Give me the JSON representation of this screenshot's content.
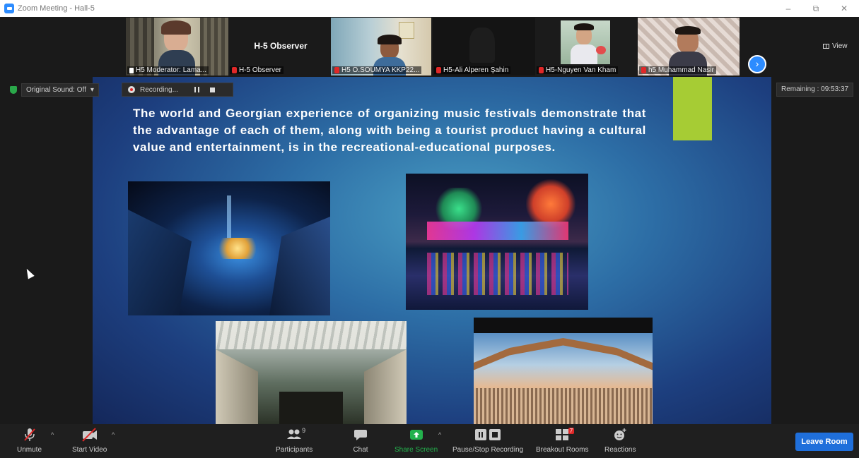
{
  "window": {
    "title": "Zoom Meeting - Hall-5",
    "controls": [
      "minimize-icon",
      "restore-icon",
      "close-icon"
    ]
  },
  "thumbnails": {
    "items": [
      {
        "label": "H5 Moderator: Lama..."
      },
      {
        "label": "H-5 Observer"
      },
      {
        "label": "H5 O.SOUMYA KKP22..."
      },
      {
        "label": "H5-Ali Alperen Şahin"
      },
      {
        "label": "H5-Nguyen Van Kham"
      },
      {
        "label": "h5 Muhammad Nasir"
      }
    ],
    "observer_title": "H-5 Observer",
    "view_label": "View"
  },
  "status": {
    "original_sound": "Original Sound: Off",
    "recording": "Recording...",
    "remaining": "Remaining : 09:53:37"
  },
  "slide": {
    "text": "The world and Georgian experience of organizing music festivals demonstrate that the advantage of each of them, along with being a tourist product having a cultural value and entertainment, is in the recreational-educational purposes."
  },
  "toolbar": {
    "unmute": "Unmute",
    "start_video": "Start Video",
    "participants": "Participants",
    "participants_count": "9",
    "chat": "Chat",
    "share_screen": "Share Screen",
    "pause_stop_recording": "Pause/Stop Recording",
    "breakout_rooms": "Breakout Rooms",
    "breakout_badge": "7",
    "reactions": "Reactions",
    "leave_room": "Leave Room"
  },
  "colors": {
    "accent": "#2d8cff",
    "leave": "#1f6fdb",
    "share_green": "#23b14d",
    "muted_red": "#e02828",
    "slide_block": "#a6cc34"
  }
}
